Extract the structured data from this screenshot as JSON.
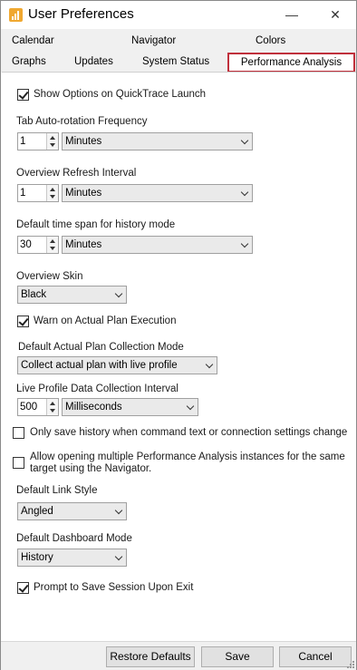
{
  "window": {
    "title": "User Preferences"
  },
  "tabs": {
    "row1": [
      "Calendar",
      "Navigator",
      "Colors"
    ],
    "row2": [
      "Graphs",
      "Updates",
      "System Status"
    ],
    "active": "Performance Analysis"
  },
  "accent": "#c0303c",
  "options": {
    "show_options": {
      "label": "Show Options on QuickTrace Launch",
      "checked": true
    },
    "tab_rotation": {
      "label": "Tab Auto-rotation Frequency",
      "value": "1",
      "unit": "Minutes"
    },
    "overview_refresh": {
      "label": "Overview Refresh Interval",
      "value": "1",
      "unit": "Minutes"
    },
    "history_span": {
      "label": "Default time span for history mode",
      "value": "30",
      "unit": "Minutes"
    },
    "overview_skin": {
      "label": "Overview Skin",
      "value": "Black"
    },
    "warn_plan": {
      "label": "Warn on Actual Plan Execution",
      "checked": true
    },
    "plan_mode": {
      "label": "Default Actual Plan Collection Mode",
      "value": "Collect actual plan with live profile"
    },
    "live_profile": {
      "label": "Live Profile Data Collection Interval",
      "value": "500",
      "unit": "Milliseconds"
    },
    "save_history": {
      "label": "Only save history when command text or connection settings change",
      "checked": false
    },
    "multi_instances": {
      "label_line1": "Allow opening multiple Performance Analysis instances for the same",
      "label_line2": "target using the Navigator.",
      "checked": false
    },
    "link_style": {
      "label": "Default Link Style",
      "value": "Angled"
    },
    "dashboard_mode": {
      "label": "Default Dashboard Mode",
      "value": "History"
    },
    "prompt_save": {
      "label": "Prompt to Save Session Upon Exit",
      "checked": true
    }
  },
  "buttons": {
    "restore": "Restore Defaults",
    "save": "Save",
    "cancel": "Cancel"
  },
  "controls": {
    "minimize": "—",
    "close": "✕"
  }
}
